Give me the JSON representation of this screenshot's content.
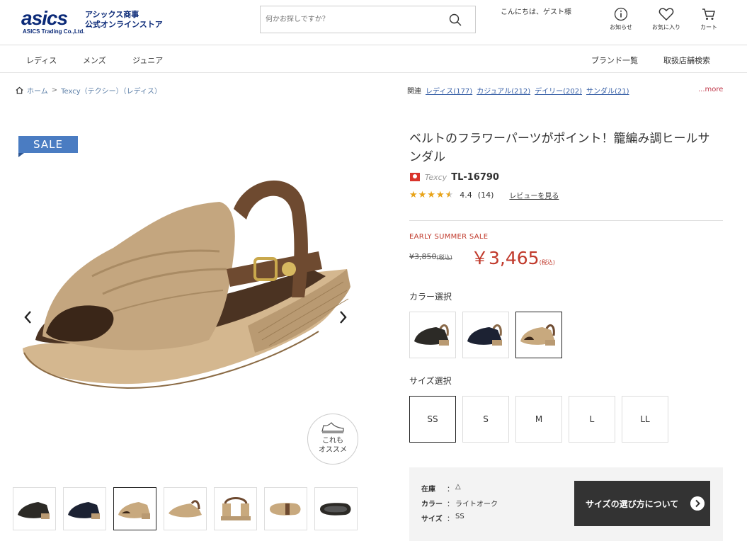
{
  "header": {
    "logo_word": "asics",
    "logo_sub": "ASICS Trading Co.,Ltd.",
    "store_line1": "アシックス商事",
    "store_line2": "公式オンラインストア",
    "search_placeholder": "何かお探しですか？",
    "greeting": "こんにちは、ゲスト様",
    "icons": [
      {
        "name": "info-icon",
        "label": "お知らせ"
      },
      {
        "name": "heart-icon",
        "label": "お気に入り"
      },
      {
        "name": "cart-icon",
        "label": "カート"
      }
    ]
  },
  "nav": {
    "left": [
      "レディス",
      "メンズ",
      "ジュニア"
    ],
    "right": [
      "ブランド一覧",
      "取扱店舗検索"
    ]
  },
  "breadcrumb": {
    "home": "ホーム",
    "separator": ">",
    "current": "Texcy（テクシー）（レディス）"
  },
  "related": {
    "label": "関連",
    "links": [
      "レディス(177)",
      "カジュアル(212)",
      "デイリー(202)",
      "サンダル(21)"
    ],
    "more": "...more"
  },
  "badge": "SALE",
  "osusume": {
    "line1": "これも",
    "line2": "オススメ"
  },
  "product": {
    "title": "ベルトのフラワーパーツがポイント！籠編み調ヒールサンダル",
    "brand": "Texcy",
    "model": "TL-16790",
    "rating": "4.4",
    "rating_value": 4.4,
    "review_count": "(14)",
    "review_link": "レビューを見る",
    "sale_label": "EARLY SUMMER SALE",
    "old_price": "¥3,850",
    "new_price": "￥3,465",
    "tax_note": "(税込)",
    "color_label": "カラー選択",
    "size_label": "サイズ選択",
    "sizes": [
      "SS",
      "S",
      "M",
      "L",
      "LL"
    ],
    "selected_size": "SS"
  },
  "info": {
    "stock_key": "在庫",
    "stock_val": "△",
    "color_key": "カラー",
    "color_val": "ライトオーク",
    "size_key": "サイズ",
    "size_val": "SS",
    "colon": "：",
    "guide_button": "サイズの選び方について"
  },
  "colors": {
    "accent": "#c0392b",
    "brand_blue": "#0b2a78",
    "badge_blue": "#4a7cc2",
    "star": "#e8a318",
    "swatch_black": "#2c2a26",
    "swatch_navy": "#1c2233",
    "swatch_beige": "#c8a97e"
  }
}
